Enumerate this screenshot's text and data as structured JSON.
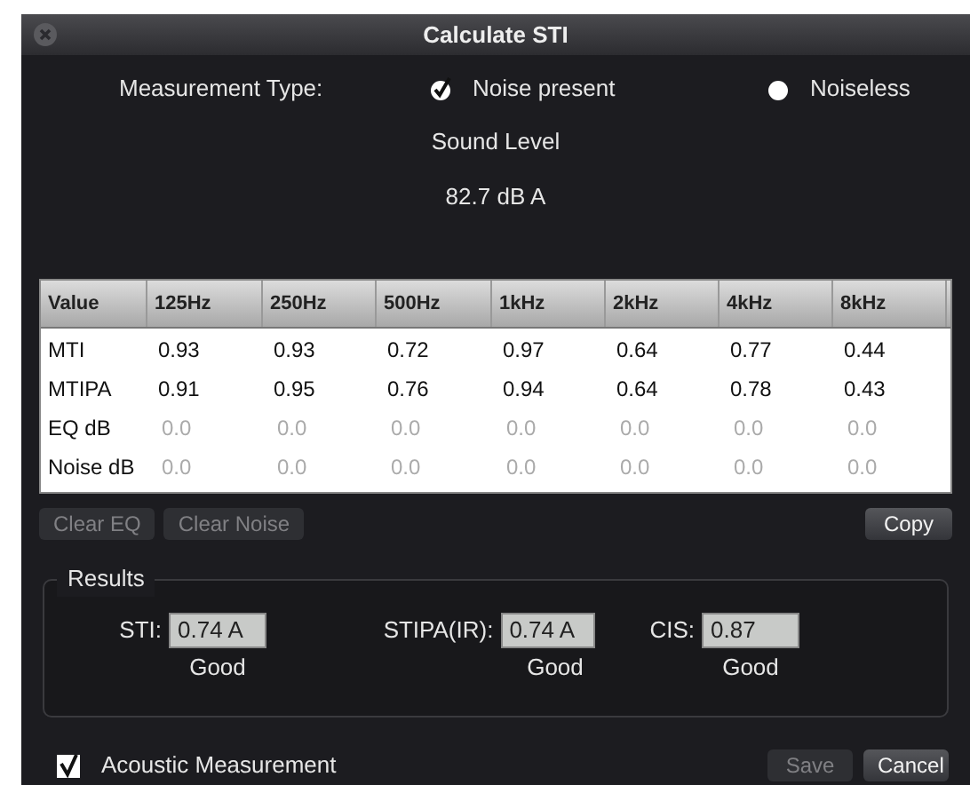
{
  "window": {
    "title": "Calculate STI"
  },
  "measurement_type": {
    "label": "Measurement Type:",
    "options": [
      {
        "label": "Noise present",
        "selected": true
      },
      {
        "label": "Noiseless",
        "selected": false
      }
    ]
  },
  "sound_level": {
    "label": "Sound Level",
    "value": "82.7 dB A"
  },
  "table": {
    "columns": [
      "Value",
      "125Hz",
      "250Hz",
      "500Hz",
      "1kHz",
      "2kHz",
      "4kHz",
      "8kHz"
    ],
    "rows": [
      {
        "dimmed": false,
        "cells": [
          "MTI",
          "0.93",
          "0.93",
          "0.72",
          "0.97",
          "0.64",
          "0.77",
          "0.44"
        ]
      },
      {
        "dimmed": false,
        "cells": [
          "MTIPA",
          "0.91",
          "0.95",
          "0.76",
          "0.94",
          "0.64",
          "0.78",
          "0.43"
        ]
      },
      {
        "dimmed": true,
        "cells": [
          "EQ dB",
          "0.0",
          "0.0",
          "0.0",
          "0.0",
          "0.0",
          "0.0",
          "0.0"
        ]
      },
      {
        "dimmed": true,
        "cells": [
          "Noise dB",
          "0.0",
          "0.0",
          "0.0",
          "0.0",
          "0.0",
          "0.0",
          "0.0"
        ]
      }
    ]
  },
  "table_buttons": [
    {
      "label": "Clear EQ",
      "disabled": true
    },
    {
      "label": "Clear Noise",
      "disabled": true
    }
  ],
  "copy_button": {
    "label": "Copy",
    "disabled": false
  },
  "results": {
    "title": "Results",
    "items": [
      {
        "label": "STI:",
        "value": "0.74 A",
        "rating": "Good"
      },
      {
        "label": "STIPA(IR):",
        "value": "0.74 A",
        "rating": "Good"
      },
      {
        "label": "CIS:",
        "value": "0.87",
        "rating": "Good"
      }
    ]
  },
  "acoustic_measurement": {
    "label": "Acoustic Measurement",
    "checked": true
  },
  "footer_buttons": [
    {
      "label": "Save",
      "disabled": true
    },
    {
      "label": "Cancel",
      "disabled": false
    }
  ]
}
